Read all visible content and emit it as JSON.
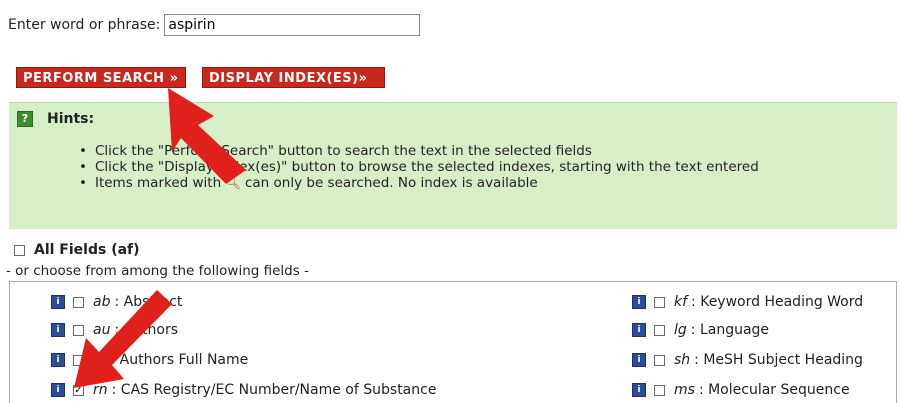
{
  "search": {
    "label": "Enter word or phrase:",
    "value": "aspirin"
  },
  "buttons": {
    "perform_search": "PERFORM SEARCH »",
    "display_index": "DISPLAY INDEX(ES)»"
  },
  "hints": {
    "icon": "?",
    "title": "Hints:",
    "items": [
      "Click the \"Perform Search\" button to search the text in the selected fields",
      "Click the \"Display Index(es)\" button to browse the selected indexes, starting with the text entered"
    ],
    "item3_before": "Items marked with",
    "item3_after": "can only be searched. No index is available"
  },
  "all_fields": {
    "label": "All Fields (af)",
    "checked": false
  },
  "choose_note": "- or choose from among the following fields -",
  "fields": {
    "left": [
      {
        "code": "ab",
        "name": ": Abstract",
        "checked": false
      },
      {
        "code": "au",
        "name": ": Authors",
        "checked": false
      },
      {
        "code": "fa",
        "name": ": Authors Full Name",
        "checked": false
      },
      {
        "code": "rn",
        "name": ": CAS Registry/EC Number/Name of Substance",
        "checked": true
      }
    ],
    "right": [
      {
        "code": "kf",
        "name": ": Keyword Heading Word",
        "checked": false
      },
      {
        "code": "lg",
        "name": ": Language",
        "checked": false
      },
      {
        "code": "sh",
        "name": ": MeSH Subject Heading",
        "checked": false
      },
      {
        "code": "ms",
        "name": ": Molecular Sequence",
        "checked": false
      }
    ]
  },
  "icons": {
    "info": "info-icon",
    "magnifier": "magnifier-icon"
  },
  "colors": {
    "button_red": "#c8291c",
    "hint_bg": "#d7efc6",
    "arrow_red": "#e0201a",
    "info_blue": "#2d4d99"
  }
}
